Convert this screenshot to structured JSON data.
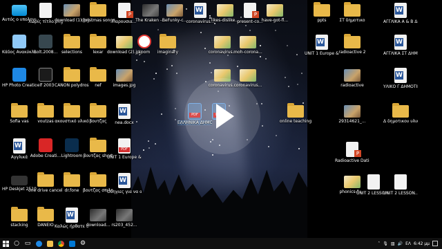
{
  "desktop_icons": [
    {
      "key": "pc",
      "label": "Αυτός ο υπολογιστής",
      "type": "pc"
    },
    {
      "key": "untitled",
      "label": "Χωρίς τίτλο.png",
      "type": "doc"
    },
    {
      "key": "download1",
      "label": "download (1).jpg",
      "type": "photo"
    },
    {
      "key": "christmas",
      "label": "christmas songs",
      "type": "folder"
    },
    {
      "key": "parousiasi",
      "label": "Παρουσια...",
      "type": "ppt"
    },
    {
      "key": "kraken",
      "label": "The Kraken -...",
      "type": "photo-dark"
    },
    {
      "key": "befunky",
      "label": "BeFunky-c...",
      "type": "photo"
    },
    {
      "key": "corona1",
      "label": "coronavirus...",
      "type": "word"
    },
    {
      "key": "likes",
      "label": "likes-dislike...",
      "type": "photo-light"
    },
    {
      "key": "present",
      "label": "present-co...",
      "type": "ppt"
    },
    {
      "key": "havegot",
      "label": "have-got-fl...",
      "type": "photo-light"
    },
    {
      "key": "ppts",
      "label": "ppts",
      "type": "folder"
    },
    {
      "key": "st_dim",
      "label": "ΣΤ δημοτικο",
      "type": "folder"
    },
    {
      "key": "agg_ab",
      "label": "ΑΓΓΛΙΚΑ Α & Β ΔΗΜΟΤΙΚ...",
      "type": "word"
    },
    {
      "key": "recycle",
      "label": "Κάδος Ανακύκλω...",
      "type": "recycle"
    },
    {
      "key": "bolt",
      "label": "Bolt.2008...",
      "type": "bolt"
    },
    {
      "key": "selections",
      "label": "selections",
      "type": "folder"
    },
    {
      "key": "lexar",
      "label": "lexar",
      "type": "folder"
    },
    {
      "key": "download2",
      "label": "download (2).jpg",
      "type": "photo-light"
    },
    {
      "key": "loom",
      "label": "Loom",
      "type": "loom"
    },
    {
      "key": "imaginary",
      "label": "imaginary",
      "type": "folder"
    },
    {
      "key": "corona_img",
      "label": "coronavirus...",
      "type": "photo-light"
    },
    {
      "key": "moh",
      "label": "moh-corona...",
      "type": "photo-light"
    },
    {
      "key": "unit1_eu",
      "label": "UNIT 1 Europe & T...",
      "type": "word"
    },
    {
      "key": "radioactive2",
      "label": "radioactive 2",
      "type": "folder"
    },
    {
      "key": "agg_st",
      "label": "ΑΓΓΛΙΚΑ ΣΤ ΔΗΜΟΤΙΚ...",
      "type": "word"
    },
    {
      "key": "hp_photo",
      "label": "HP Photo Creations",
      "type": "hp"
    },
    {
      "key": "elf",
      "label": "elf 2003",
      "type": "elf"
    },
    {
      "key": "canon",
      "label": "CANON polydros...",
      "type": "folder"
    },
    {
      "key": "nef",
      "label": "nef",
      "type": "folder"
    },
    {
      "key": "images",
      "label": "images.jpg",
      "type": "photo"
    },
    {
      "key": "corona3",
      "label": "coronavirus...",
      "type": "photo-light"
    },
    {
      "key": "corona4",
      "label": "coronavirus...",
      "type": "photo-light"
    },
    {
      "key": "radioactive",
      "label": "radioactive",
      "type": "photo"
    },
    {
      "key": "yliko",
      "label": "ΥΛΙΚΟ Γ ΔΗΜΟΤΙΚ...",
      "type": "word"
    },
    {
      "key": "sofia",
      "label": "Sofia vas",
      "type": "folder"
    },
    {
      "key": "voutzas",
      "label": "voutzas",
      "type": "folder"
    },
    {
      "key": "akoust",
      "label": "ακουστικό υλικό",
      "type": "folder"
    },
    {
      "key": "voutzas2",
      "label": "βουτζας",
      "type": "folder"
    },
    {
      "key": "nea",
      "label": "nea.docx",
      "type": "word"
    },
    {
      "key": "selpdf1",
      "label": "ΕΛΛΗΝΙΚΑ ΔΗΜΟΤΙΚΟΥ",
      "type": "pdf"
    },
    {
      "key": "selpdf2",
      "label": "",
      "type": "pdf"
    },
    {
      "key": "online",
      "label": "online teaching",
      "type": "folder"
    },
    {
      "key": "num29314",
      "label": "29314621_...",
      "type": "photo"
    },
    {
      "key": "d_dim",
      "label": "Δ δημοτικου υλικο",
      "type": "folder"
    },
    {
      "key": "agglika",
      "label": "Αγγλικά",
      "type": "word"
    },
    {
      "key": "adobe",
      "label": "Adobe Creati...",
      "type": "adobe"
    },
    {
      "key": "lightroom",
      "label": "Lightroom",
      "type": "lr"
    },
    {
      "key": "voutzas_short",
      "label": "βουτζας short",
      "type": "folder"
    },
    {
      "key": "unit1_pdf",
      "label": "UNIT 1 Europe & T...",
      "type": "pdf"
    },
    {
      "key": "radioactive_ppt",
      "label": "Radioactive Dating.pptx",
      "type": "ppt"
    },
    {
      "key": "hp_deskjet",
      "label": "HP Deskjet 2510 series",
      "type": "printer"
    },
    {
      "key": "onedrive",
      "label": "one drive cancel sub...",
      "type": "folder"
    },
    {
      "key": "drfone",
      "label": "dr.fone",
      "type": "folder"
    },
    {
      "key": "voutzas_sp",
      "label": "βουτζας σπιλο",
      "type": "folder"
    },
    {
      "key": "odigies",
      "label": "Οδηγιες για να ανοιξου...",
      "type": "word"
    },
    {
      "key": "phonics",
      "label": "phonics-fu...",
      "type": "photo-light"
    },
    {
      "key": "unit2_1",
      "label": "UNIT 2 LESSON...",
      "type": "doc"
    },
    {
      "key": "unit2_2",
      "label": "UNIT 2 LESSON...",
      "type": "doc"
    },
    {
      "key": "stacking",
      "label": "stacking",
      "type": "folder"
    },
    {
      "key": "daneio",
      "label": "DANEIO",
      "type": "folder"
    },
    {
      "key": "kalos",
      "label": "Καλώς ήρθατε στ...",
      "type": "word"
    },
    {
      "key": "downloadx",
      "label": "download...",
      "type": "photo-dark"
    },
    {
      "key": "rs203",
      "label": "rs203_452...",
      "type": "photo-dark"
    }
  ],
  "taskbar": {
    "search_icon": "search-icon",
    "language": "ΕΛ",
    "time": "6:42 μμ"
  }
}
